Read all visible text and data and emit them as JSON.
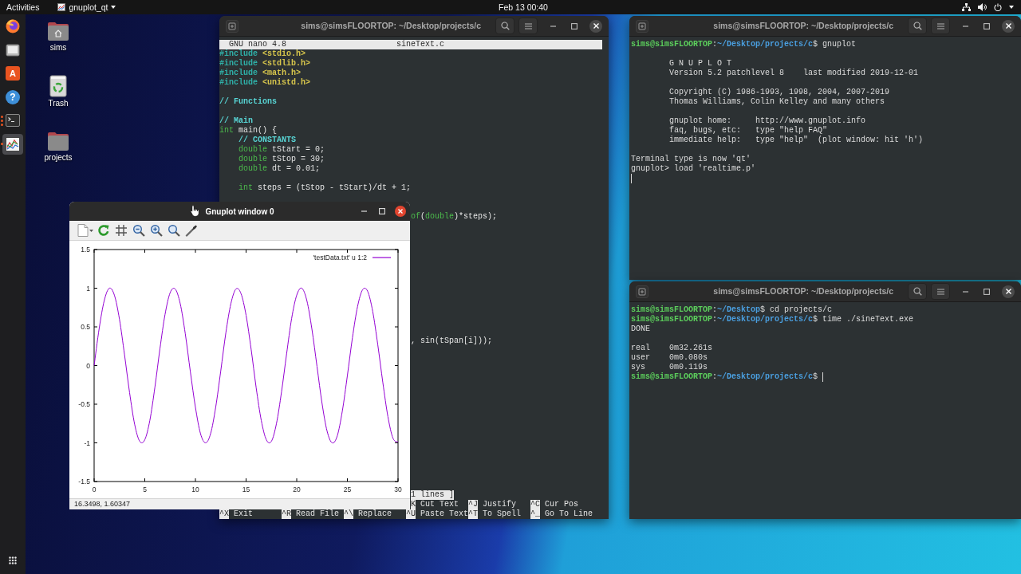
{
  "top_bar": {
    "activities": "Activities",
    "app_menu": "gnuplot_qt",
    "clock": "Feb 13 00:40"
  },
  "dock": [
    {
      "kind": "browser",
      "selected": false
    },
    {
      "kind": "files",
      "selected": false
    },
    {
      "kind": "software",
      "glyph": "A",
      "selected": false
    },
    {
      "kind": "help",
      "glyph": "?",
      "selected": false
    },
    {
      "kind": "terminal",
      "selected": false,
      "running_windows": [
        true,
        true,
        true
      ]
    },
    {
      "kind": "gnuplot",
      "selected": true,
      "running_windows": [
        true
      ]
    }
  ],
  "desktop": [
    {
      "kind": "home",
      "label": "sims"
    },
    {
      "kind": "trash",
      "label": "Trash"
    },
    {
      "kind": "folder",
      "label": "projects"
    }
  ],
  "nano_window": {
    "title": "sims@simsFLOORTOP: ~/Desktop/projects/c",
    "app": "GNU nano 4.8",
    "file": "sineText.c",
    "lines": [
      {
        "kind": "text",
        "segments": [
          {
            "kind": "preproc",
            "text": "#include "
          },
          {
            "kind": "header",
            "text": "<stdio.h>"
          }
        ]
      },
      {
        "kind": "text",
        "segments": [
          {
            "kind": "preproc",
            "text": "#include "
          },
          {
            "kind": "header",
            "text": "<stdlib.h>"
          }
        ]
      },
      {
        "kind": "text",
        "segments": [
          {
            "kind": "preproc",
            "text": "#include "
          },
          {
            "kind": "header",
            "text": "<math.h>"
          }
        ]
      },
      {
        "kind": "text",
        "segments": [
          {
            "kind": "preproc",
            "text": "#include "
          },
          {
            "kind": "header",
            "text": "<unistd.h>"
          }
        ]
      },
      {
        "kind": "blank"
      },
      {
        "kind": "text",
        "segments": [
          {
            "kind": "comment",
            "text": "// Functions"
          }
        ]
      },
      {
        "kind": "blank"
      },
      {
        "kind": "text",
        "segments": [
          {
            "kind": "comment",
            "text": "// Main"
          }
        ]
      },
      {
        "kind": "text",
        "segments": [
          {
            "kind": "type",
            "text": "int"
          },
          {
            "kind": "plain",
            "text": " main() {"
          }
        ]
      },
      {
        "kind": "text",
        "segments": [
          {
            "kind": "comment",
            "text": "    // CONSTANTS"
          }
        ]
      },
      {
        "kind": "text",
        "segments": [
          {
            "kind": "type",
            "text": "    double"
          },
          {
            "kind": "plain",
            "text": " tStart = 0;"
          }
        ]
      },
      {
        "kind": "text",
        "segments": [
          {
            "kind": "type",
            "text": "    double"
          },
          {
            "kind": "plain",
            "text": " tStop = 30;"
          }
        ]
      },
      {
        "kind": "text",
        "segments": [
          {
            "kind": "type",
            "text": "    double"
          },
          {
            "kind": "plain",
            "text": " dt = 0.01;"
          }
        ]
      },
      {
        "kind": "blank"
      },
      {
        "kind": "text",
        "segments": [
          {
            "kind": "type",
            "text": "    int"
          },
          {
            "kind": "plain",
            "text": " steps = (tStop - tStart)/dt + 1;"
          }
        ]
      },
      {
        "kind": "blank"
      },
      {
        "kind": "blank"
      },
      {
        "kind": "clipped",
        "segments": [
          {
            "kind": "type",
            "text": "of"
          },
          {
            "kind": "plain",
            "text": "("
          },
          {
            "kind": "type",
            "text": "double"
          },
          {
            "kind": "plain",
            "text": ")*steps);"
          }
        ]
      },
      {
        "kind": "blank"
      },
      {
        "kind": "blank"
      },
      {
        "kind": "blank"
      },
      {
        "kind": "blank"
      },
      {
        "kind": "blank"
      },
      {
        "kind": "blank"
      },
      {
        "kind": "blank"
      },
      {
        "kind": "blank"
      },
      {
        "kind": "blank"
      },
      {
        "kind": "blank"
      },
      {
        "kind": "blank"
      },
      {
        "kind": "blank"
      },
      {
        "kind": "clipped",
        "segments": [
          {
            "kind": "plain",
            "text": ", sin(tSpan[i]));"
          }
        ]
      }
    ],
    "status": "1 lines ]",
    "shortcuts": [
      [
        {
          "key": "K",
          "label": "Cut Text"
        },
        {
          "key": "^J",
          "label": "Justify"
        },
        {
          "key": "^C",
          "label": "Cur Pos"
        }
      ],
      [
        {
          "key": "^X",
          "label": "Exit"
        },
        {
          "key": "^R",
          "label": "Read File"
        },
        {
          "key": "^\\",
          "label": "Replace"
        },
        {
          "key": "^U",
          "label": "Paste Text"
        },
        {
          "key": "^T",
          "label": "To Spell"
        },
        {
          "key": "^_",
          "label": "Go To Line"
        }
      ]
    ]
  },
  "gnuplot_window": {
    "title": "Gnuplot window 0",
    "chart_data": {
      "type": "line",
      "x": [
        0,
        0.5,
        1,
        1.5,
        2,
        2.5,
        3,
        3.5,
        4,
        4.5,
        5,
        5.5,
        6,
        6.5,
        7,
        7.5,
        8,
        8.5,
        9,
        9.5,
        10,
        10.5,
        11,
        11.5,
        12,
        12.5,
        13,
        13.5,
        14,
        14.5,
        15,
        15.5,
        16,
        16.5,
        17,
        17.5,
        18,
        18.5,
        19,
        19.5,
        20,
        20.5,
        21,
        21.5,
        22,
        22.5,
        23,
        23.5,
        24,
        24.5,
        25,
        25.5,
        26,
        26.5,
        27,
        27.5,
        28,
        28.5,
        29,
        29.5,
        30
      ],
      "series": [
        {
          "name": "'testData.txt' u 1:2",
          "color": "#9400d3",
          "values": [
            0,
            0.48,
            0.84,
            1,
            0.91,
            0.6,
            0.14,
            -0.35,
            -0.76,
            -0.98,
            -0.96,
            -0.71,
            -0.28,
            0.22,
            0.66,
            0.94,
            0.99,
            0.8,
            0.41,
            -0.08,
            -0.54,
            -0.88,
            -1,
            -0.88,
            -0.54,
            -0.07,
            0.42,
            0.8,
            0.99,
            0.93,
            0.65,
            0.21,
            -0.29,
            -0.71,
            -0.96,
            -0.98,
            -0.75,
            -0.34,
            0.15,
            0.61,
            0.91,
            1,
            0.84,
            0.47,
            -0.01,
            -0.49,
            -0.85,
            -1,
            -0.91,
            -0.59,
            -0.13,
            0.36,
            0.76,
            0.98,
            0.96,
            0.7,
            0.27,
            -0.22,
            -0.66,
            -0.94,
            -0.99
          ]
        }
      ],
      "xlim": [
        0,
        30
      ],
      "ylim": [
        -1.5,
        1.5
      ],
      "xticks": [
        0,
        5,
        10,
        15,
        20,
        25,
        30
      ],
      "yticks": [
        -1.5,
        -1,
        -0.5,
        0,
        0.5,
        1,
        1.5
      ]
    },
    "status": "16.3498, 1.60347"
  },
  "terminals": [
    {
      "title": "sims@simsFLOORTOP: ~/Desktop/projects/c",
      "lines": [
        {
          "kind": "text",
          "segments": [
            {
              "kind": "user",
              "text": "sims@simsFLOORTOP"
            },
            {
              "kind": "plain",
              "text": ":"
            },
            {
              "kind": "path",
              "text": "~/Desktop/projects/c"
            },
            {
              "kind": "plain",
              "text": "$ gnuplot"
            }
          ]
        },
        {
          "kind": "blank"
        },
        {
          "kind": "text",
          "segments": [
            {
              "kind": "plain",
              "text": "        G N U P L O T"
            }
          ]
        },
        {
          "kind": "text",
          "segments": [
            {
              "kind": "plain",
              "text": "        Version 5.2 patchlevel 8    last modified 2019-12-01"
            }
          ]
        },
        {
          "kind": "blank"
        },
        {
          "kind": "text",
          "segments": [
            {
              "kind": "plain",
              "text": "        Copyright (C) 1986-1993, 1998, 2004, 2007-2019"
            }
          ]
        },
        {
          "kind": "text",
          "segments": [
            {
              "kind": "plain",
              "text": "        Thomas Williams, Colin Kelley and many others"
            }
          ]
        },
        {
          "kind": "blank"
        },
        {
          "kind": "text",
          "segments": [
            {
              "kind": "plain",
              "text": "        gnuplot home:     http://www.gnuplot.info"
            }
          ]
        },
        {
          "kind": "text",
          "segments": [
            {
              "kind": "plain",
              "text": "        faq, bugs, etc:   type \"help FAQ\""
            }
          ]
        },
        {
          "kind": "text",
          "segments": [
            {
              "kind": "plain",
              "text": "        immediate help:   type \"help\"  (plot window: hit 'h')"
            }
          ]
        },
        {
          "kind": "blank"
        },
        {
          "kind": "text",
          "segments": [
            {
              "kind": "plain",
              "text": "Terminal type is now 'qt'"
            }
          ]
        },
        {
          "kind": "text",
          "segments": [
            {
              "kind": "plain",
              "text": "gnuplot> load 'realtime.p'"
            }
          ]
        },
        {
          "kind": "text",
          "segments": [
            {
              "kind": "cursor"
            }
          ]
        }
      ]
    },
    {
      "title": "sims@simsFLOORTOP: ~/Desktop/projects/c",
      "lines": [
        {
          "kind": "text",
          "segments": [
            {
              "kind": "user",
              "text": "sims@simsFLOORTOP"
            },
            {
              "kind": "plain",
              "text": ":"
            },
            {
              "kind": "path",
              "text": "~/Desktop"
            },
            {
              "kind": "plain",
              "text": "$ cd projects/c"
            }
          ]
        },
        {
          "kind": "text",
          "segments": [
            {
              "kind": "user",
              "text": "sims@simsFLOORTOP"
            },
            {
              "kind": "plain",
              "text": ":"
            },
            {
              "kind": "path",
              "text": "~/Desktop/projects/c"
            },
            {
              "kind": "plain",
              "text": "$ time ./sineText.exe"
            }
          ]
        },
        {
          "kind": "text",
          "segments": [
            {
              "kind": "plain",
              "text": "DONE"
            }
          ]
        },
        {
          "kind": "blank"
        },
        {
          "kind": "text",
          "segments": [
            {
              "kind": "plain",
              "text": "real    0m32.261s"
            }
          ]
        },
        {
          "kind": "text",
          "segments": [
            {
              "kind": "plain",
              "text": "user    0m0.080s"
            }
          ]
        },
        {
          "kind": "text",
          "segments": [
            {
              "kind": "plain",
              "text": "sys     0m0.119s"
            }
          ]
        },
        {
          "kind": "text",
          "segments": [
            {
              "kind": "user",
              "text": "sims@simsFLOORTOP"
            },
            {
              "kind": "plain",
              "text": ":"
            },
            {
              "kind": "path",
              "text": "~/Desktop/projects/c"
            },
            {
              "kind": "plain",
              "text": "$ "
            },
            {
              "kind": "cursor"
            }
          ]
        }
      ]
    }
  ]
}
